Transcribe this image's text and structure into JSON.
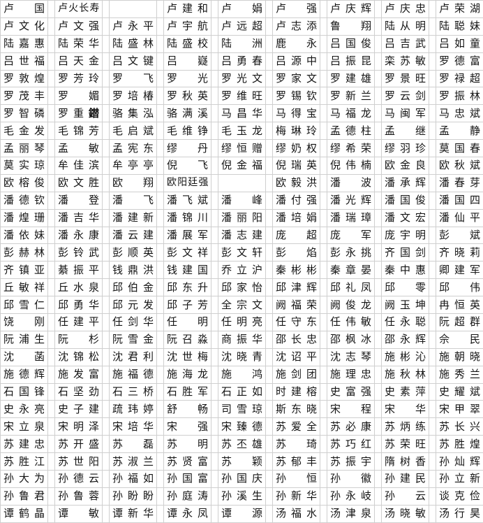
{
  "table": {
    "name": "chinese-name-roster",
    "columns": 9,
    "rows": 29,
    "grid_color": "#cfcfcf",
    "text_color": "#141414",
    "background": "#ffffff",
    "rows_data": [
      [
        "卢国",
        "卢火长寿",
        "",
        "卢建和",
        "卢娟",
        "卢强",
        "卢庆辉",
        "卢庆忠",
        "卢荣湖"
      ],
      [
        "卢文化",
        "卢文强",
        "卢永平",
        "卢宇航",
        "卢远超",
        "卢志添",
        "鲁翔",
        "陆从明",
        "陆聪妹"
      ],
      [
        "陆嘉惠",
        "陆荣华",
        "陆盛林",
        "陆盛校",
        "陆洲",
        "鹿永",
        "吕国俊",
        "吕吉武",
        "吕如童"
      ],
      [
        "吕世福",
        "吕天金",
        "吕文键",
        "吕嶷",
        "吕勇春",
        "吕源中",
        "吕振昆",
        "栾苏敏",
        "罗德富"
      ],
      [
        "罗敦煌",
        "罗芳玲",
        "罗飞",
        "罗光",
        "罗光文",
        "罗家文",
        "罗建雄",
        "罗景旺",
        "罗禄超"
      ],
      [
        "罗茂丰",
        "罗媚",
        "罗培椿",
        "罗秋英",
        "罗维旺",
        "罗锡钦",
        "罗新兰",
        "罗云剑",
        "罗振林"
      ],
      [
        "罗智磷",
        "罗重鐟",
        "骆集泓",
        "骆满溪",
        "马昌华",
        "马得宝",
        "马福龙",
        "马闽军",
        "马忠斌"
      ],
      [
        "毛金发",
        "毛锦芳",
        "毛启斌",
        "毛维铮",
        "毛玉龙",
        "梅琳玲",
        "孟德柱",
        "孟继",
        "孟静"
      ],
      [
        "孟丽琴",
        "孟敏",
        "孟宪东",
        "缪丹",
        "缪恒赠",
        "缪奶权",
        "缪希荣",
        "缪羽珍",
        "莫国春"
      ],
      [
        "莫实琼",
        "牟佳滨",
        "牟亭亭",
        "倪飞",
        "倪金福",
        "倪瑞英",
        "倪伟楠",
        "欧金良",
        "欧秋斌"
      ],
      [
        "欧榕俊",
        "欧文胜",
        "欧翔",
        "欧阳廷强",
        "",
        "欧毅洪",
        "潘波",
        "潘承辉",
        "潘春芽"
      ],
      [
        "潘德钦",
        "潘登",
        "潘飞",
        "潘飞斌",
        "潘峰",
        "潘付强",
        "潘光辉",
        "潘国俊",
        "潘国四"
      ],
      [
        "潘煌珊",
        "潘吉华",
        "潘建新",
        "潘锦川",
        "潘丽阳",
        "潘培娟",
        "潘瑞璋",
        "潘文宏",
        "潘仙平"
      ],
      [
        "潘依妹",
        "潘永康",
        "潘云建",
        "潘展军",
        "潘志建",
        "庞超",
        "庞军",
        "庞宇明",
        "彭斌"
      ],
      [
        "彭赫林",
        "彭铃武",
        "彭顺英",
        "彭文祥",
        "彭文轩",
        "彭焰",
        "彭永挑",
        "齐国剑",
        "齐晓莉"
      ],
      [
        "齐镇亚",
        "綦振平",
        "钱鼎洪",
        "钱建国",
        "乔立沪",
        "秦彬彬",
        "秦章晏",
        "秦中惠",
        "卿建军"
      ],
      [
        "丘敏祥",
        "丘水泉",
        "邱伯金",
        "邱东升",
        "邱家怡",
        "邱津辉",
        "邱礼凤",
        "邱零",
        "邱伟"
      ],
      [
        "邱雪仁",
        "邱勇华",
        "邱元发",
        "邱子芳",
        "全宗文",
        "阙福荣",
        "阙俊龙",
        "阙玉坤",
        "冉恒英"
      ],
      [
        "饶刚",
        "任建平",
        "任剑华",
        "任明",
        "任明亮",
        "任守东",
        "任伟敏",
        "任永聪",
        "阮超群"
      ],
      [
        "阮浦生",
        "阮杉",
        "阮雪金",
        "阮召淼",
        "商振华",
        "邵长忠",
        "邵枫冰",
        "邵永辉",
        "佘民"
      ],
      [
        "沈菡",
        "沈锦松",
        "沈君利",
        "沈世梅",
        "沈晓青",
        "沈诏平",
        "沈志琴",
        "施彬沁",
        "施朝晓"
      ],
      [
        "施德辉",
        "施发富",
        "施福德",
        "施海龙",
        "施鸿",
        "施剑团",
        "施理忠",
        "施秋林",
        "施秀兰"
      ],
      [
        "石国锋",
        "石坚劲",
        "石三桥",
        "石胜军",
        "石正如",
        "时建榕",
        "史富强",
        "史素萍",
        "史耀斌"
      ],
      [
        "史永亮",
        "史子建",
        "疏玮婷",
        "舒畅",
        "司雪琼",
        "斯东晓",
        "宋程",
        "宋华",
        "宋甲翠"
      ],
      [
        "宋立泉",
        "宋明泽",
        "宋培华",
        "宋强",
        "宋臻德",
        "苏爱全",
        "苏必康",
        "苏炳练",
        "苏长兴"
      ],
      [
        "苏建忠",
        "苏开盛",
        "苏磊",
        "苏明",
        "苏丕雄",
        "苏琦",
        "苏巧红",
        "苏荣旺",
        "苏胜煌"
      ],
      [
        "苏胜江",
        "苏世阳",
        "苏淑兰",
        "苏贤富",
        "苏颖",
        "苏郁丰",
        "苏振宇",
        "隋树香",
        "孙灿辉"
      ],
      [
        "孙大为",
        "孙德云",
        "孙福如",
        "孙国富",
        "孙国庆",
        "孙恒",
        "孙徽",
        "孙建民",
        "孙立新"
      ],
      [
        "孙鲁君",
        "孙鲁蓉",
        "孙盼盼",
        "孙庭涛",
        "孙溪生",
        "孙新华",
        "孙永岐",
        "孙云",
        "谈克俭"
      ],
      [
        "谭鹤晶",
        "谭敏",
        "谭新华",
        "谭永凤",
        "谭源",
        "汤福水",
        "汤津泉",
        "汤晓敏",
        "汤行昊"
      ]
    ],
    "fallback_glyph_cells": [
      {
        "row": 6,
        "col": 1,
        "index": 2
      }
    ]
  }
}
